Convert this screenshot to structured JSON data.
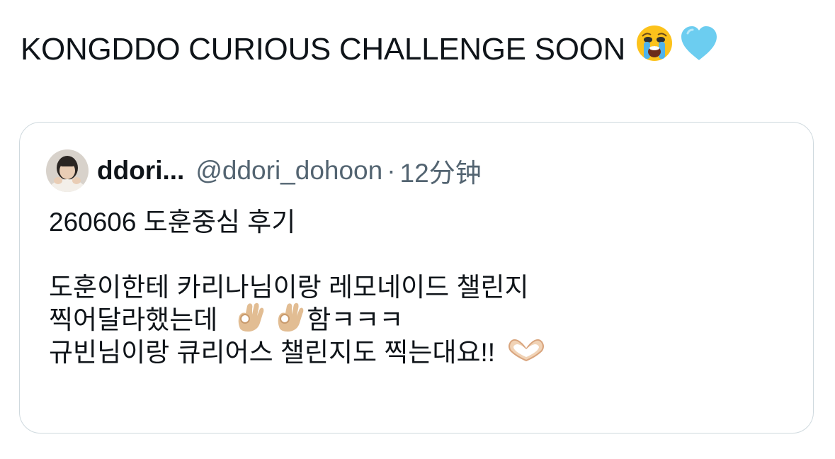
{
  "tweet": {
    "text": "KONGDDO CURIOUS CHALLENGE SOON",
    "emojis": [
      "crying-face-icon",
      "light-blue-heart-icon"
    ]
  },
  "quoted_tweet": {
    "display_name": "ddori...",
    "handle": "@ddori_dohoon",
    "separator": "·",
    "timestamp": "12分钟",
    "lines": [
      "260606 도훈중심 후기",
      "",
      "도훈이한테 카리나님이랑 레모네이드 챌린지",
      "찍어달라했는데",
      "함ㅋㅋㅋ",
      "규빈님이랑 큐리어스 챌린지도 찍는대요!!"
    ],
    "inline_emojis": [
      "ok-hand-icon",
      "ok-hand-icon",
      "heart-hands-icon"
    ]
  },
  "colors": {
    "text_primary": "#0f1419",
    "text_secondary": "#536471",
    "card_border": "#cfd9de",
    "skin_tone": "#e2bd93"
  }
}
